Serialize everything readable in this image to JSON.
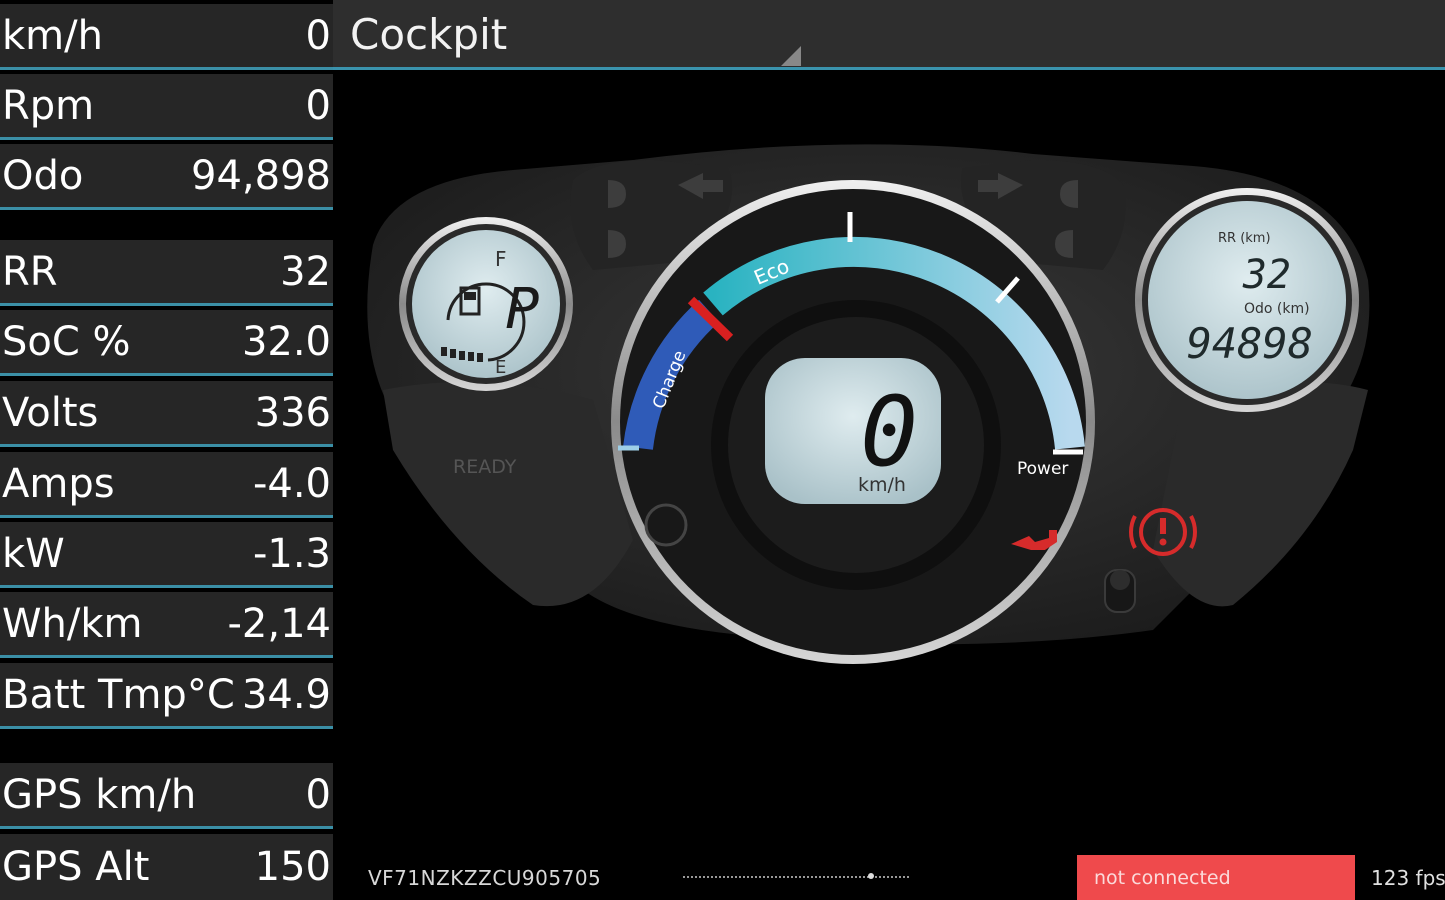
{
  "header": {
    "title": "Cockpit"
  },
  "stats": {
    "speed": {
      "label": "km/h",
      "value": "0"
    },
    "rpm": {
      "label": "Rpm",
      "value": "0"
    },
    "odo": {
      "label": "Odo",
      "value": "94,898"
    },
    "rr": {
      "label": "RR",
      "value": "32"
    },
    "soc": {
      "label": "SoC %",
      "value": "32.0"
    },
    "volts": {
      "label": "Volts",
      "value": "336"
    },
    "amps": {
      "label": "Amps",
      "value": "-4.0"
    },
    "kw": {
      "label": "kW",
      "value": "-1.3"
    },
    "whkm": {
      "label": "Wh/km",
      "value": "-2,14"
    },
    "batt_temp": {
      "label": "Batt Tmp°C",
      "value": "34.9"
    },
    "gps_speed": {
      "label": "GPS km/h",
      "value": "0"
    },
    "gps_alt": {
      "label": "GPS Alt",
      "value": "150"
    }
  },
  "cluster": {
    "left_gauge": {
      "gear": "P",
      "full_mark": "F",
      "empty_mark": "E"
    },
    "center": {
      "speed": "0",
      "unit": "km/h",
      "zone_charge": "Charge",
      "zone_eco": "Eco",
      "zone_power": "Power"
    },
    "right_gauge": {
      "rr_label": "RR (km)",
      "rr_value": "32",
      "odo_label": "Odo (km)",
      "odo_value": "94898"
    },
    "ready_label": "READY"
  },
  "footer": {
    "vin": "VF71NZKZZCU905705",
    "status": "not connected",
    "fps": "123 fps"
  },
  "colors": {
    "status_bg": "#ef4a4c",
    "accent_line": "#3b8fa6",
    "lcd": "#c2d6dc",
    "charge_zone": "#2f5bb8",
    "eco_zone": "#33b6c4"
  }
}
